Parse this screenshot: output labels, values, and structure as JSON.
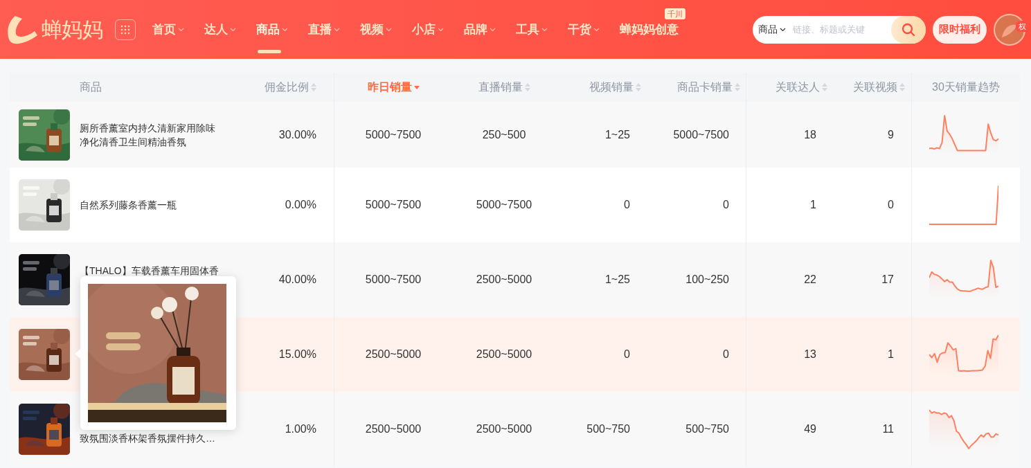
{
  "header": {
    "logo_text": "蝉妈妈",
    "nav": [
      {
        "label": "首页",
        "selected": false,
        "dropdown": true
      },
      {
        "label": "达人",
        "selected": false,
        "dropdown": true
      },
      {
        "label": "商品",
        "selected": true,
        "dropdown": true
      },
      {
        "label": "直播",
        "selected": false,
        "dropdown": true
      },
      {
        "label": "视频",
        "selected": false,
        "dropdown": true
      },
      {
        "label": "小店",
        "selected": false,
        "dropdown": true
      },
      {
        "label": "品牌",
        "selected": false,
        "dropdown": true
      },
      {
        "label": "工具",
        "selected": false,
        "dropdown": true
      },
      {
        "label": "干货",
        "selected": false,
        "dropdown": true
      },
      {
        "label": "蝉妈妈创意",
        "selected": false,
        "dropdown": false,
        "badge": "千川"
      }
    ],
    "search": {
      "scope": "商品",
      "placeholder": "链接、标题或关键"
    },
    "promo_button": "限时福利",
    "avatar_badge": "权"
  },
  "table": {
    "columns": [
      {
        "label": "商品"
      },
      {
        "label": "佣金比例",
        "sorted": false
      },
      {
        "label": "昨日销量",
        "sorted": true
      },
      {
        "label": "直播销量",
        "sorted": false
      },
      {
        "label": "视频销量",
        "sorted": false
      },
      {
        "label": "商品卡销量",
        "sorted": false
      },
      {
        "label": "关联达人",
        "sorted": false
      },
      {
        "label": "关联视频",
        "sorted": false
      },
      {
        "label": "30天销量趋势"
      }
    ],
    "rows": [
      {
        "product": {
          "lines": [
            "厕所香薰室内持久清新家用除味",
            "净化清香卫生间精油香氛"
          ]
        },
        "commission": "30.00%",
        "yesterday": "5000~7500",
        "live": "250~500",
        "video": "1~25",
        "card": "5000~7500",
        "creators": "18",
        "videos": "9",
        "highlighted": false
      },
      {
        "product": {
          "lines": [
            "自然系列藤条香薰一瓶"
          ]
        },
        "commission": "0.00%",
        "yesterday": "5000~7500",
        "live": "5000~7500",
        "video": "0",
        "card": "0",
        "creators": "1",
        "videos": "0",
        "highlighted": false
      },
      {
        "product": {
          "lines": [
            "【THALO】车载香薰车用固体香"
          ]
        },
        "commission": "40.00%",
        "yesterday": "5000~7500",
        "live": "2500~5000",
        "video": "1~25",
        "card": "100~250",
        "creators": "22",
        "videos": "17",
        "highlighted": false
      },
      {
        "commission": "15.00%",
        "yesterday": "2500~5000",
        "live": "2500~5000",
        "video": "0",
        "card": "0",
        "creators": "13",
        "videos": "1",
        "highlighted": true
      },
      {
        "product": {
          "lines": [
            "致氛围淡香杯架香氛摆件持久…"
          ]
        },
        "commission": "1.00%",
        "yesterday": "2500~5000",
        "live": "2500~5000",
        "video": "500~750",
        "card": "500~750",
        "creators": "49",
        "videos": "11",
        "highlighted": false
      }
    ]
  }
}
